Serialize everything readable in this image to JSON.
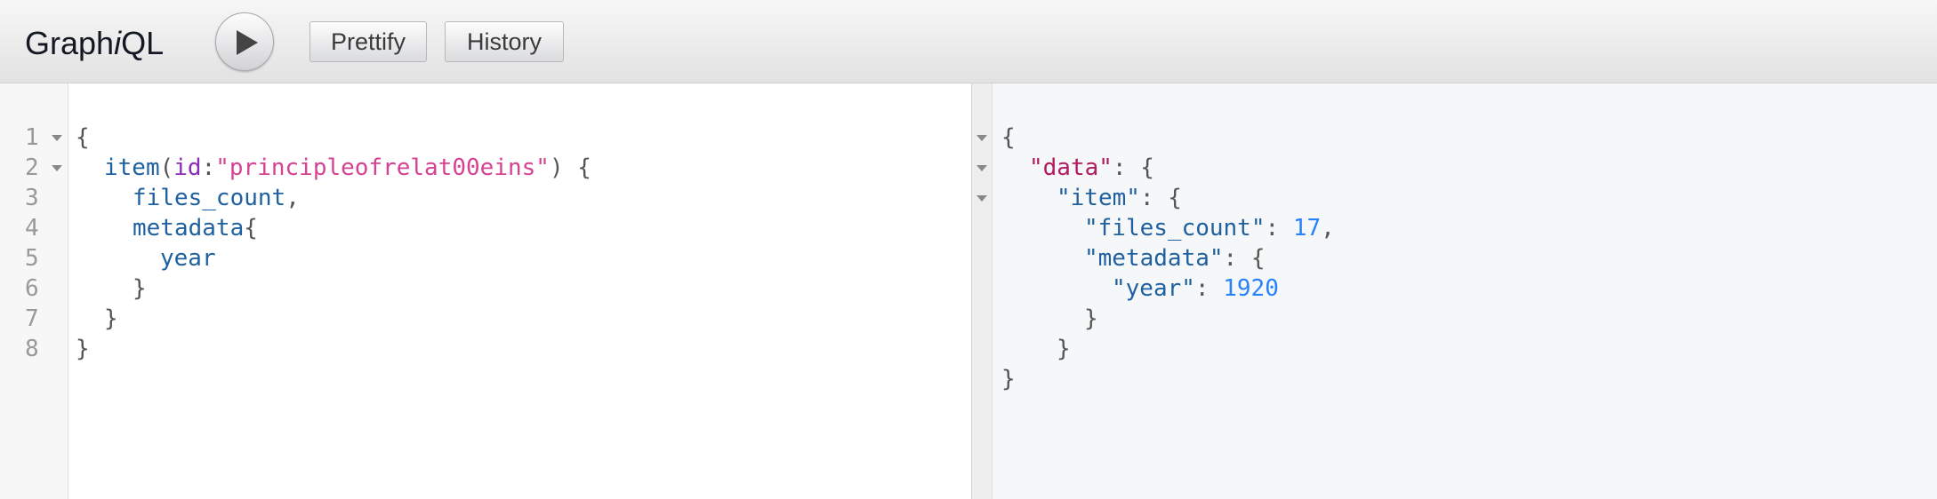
{
  "app": {
    "title_prefix": "Graph",
    "title_italic": "i",
    "title_suffix": "QL",
    "execute_icon": "play-icon"
  },
  "toolbar": {
    "prettify_label": "Prettify",
    "history_label": "History"
  },
  "query_editor": {
    "line_numbers": [
      "1",
      "2",
      "3",
      "4",
      "5",
      "6",
      "7",
      "8"
    ],
    "lines": [
      {
        "brace": "{"
      },
      {
        "field": "item",
        "open_paren": "(",
        "arg": "id",
        "colon": ":",
        "value": "\"principleofrelat00eins\"",
        "close": ") {"
      },
      {
        "field": "files_count",
        "trail": ","
      },
      {
        "field": "metadata",
        "trail": "{"
      },
      {
        "field": "year"
      },
      {
        "brace": "}"
      },
      {
        "brace": "}"
      },
      {
        "brace": "}"
      }
    ]
  },
  "result_viewer": {
    "lines": [
      {
        "text": "{"
      },
      {
        "key": "\"data\"",
        "rest": ": {"
      },
      {
        "key": "\"item\"",
        "rest": ": {"
      },
      {
        "key": "\"files_count\"",
        "sep": ": ",
        "value": "17",
        "trail": ","
      },
      {
        "key": "\"metadata\"",
        "rest": ": {"
      },
      {
        "key": "\"year\"",
        "sep": ": ",
        "value": "1920"
      },
      {
        "text": "}"
      },
      {
        "text": "}"
      },
      {
        "text": "}"
      }
    ]
  }
}
